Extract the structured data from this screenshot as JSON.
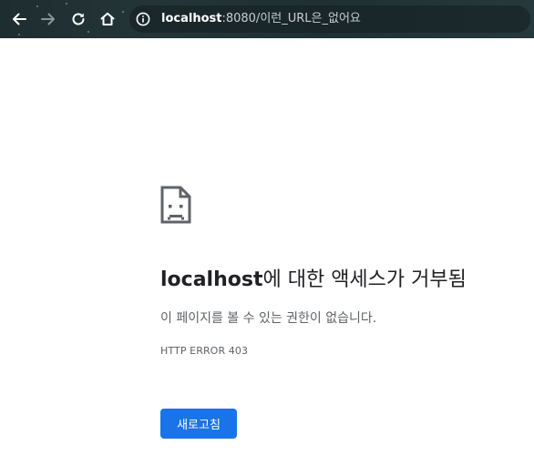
{
  "browser": {
    "url_host": "localhost",
    "url_rest": ":8080/이런_URL은_없어요"
  },
  "error_page": {
    "heading_host": "localhost",
    "heading_rest": "에 대한 액세스가 거부됨",
    "message": "이 페이지를 볼 수 있는 권한이 없습니다.",
    "error_code": "HTTP ERROR 403",
    "reload_label": "새로고침"
  },
  "icons": {
    "back": "back-arrow-icon",
    "forward": "forward-arrow-icon",
    "reload": "reload-icon",
    "home": "home-icon",
    "site_info": "info-icon",
    "page_error": "sad-document-icon"
  },
  "colors": {
    "accent": "#1a73e8",
    "heading_text": "#202124",
    "body_text": "#5f6368"
  }
}
